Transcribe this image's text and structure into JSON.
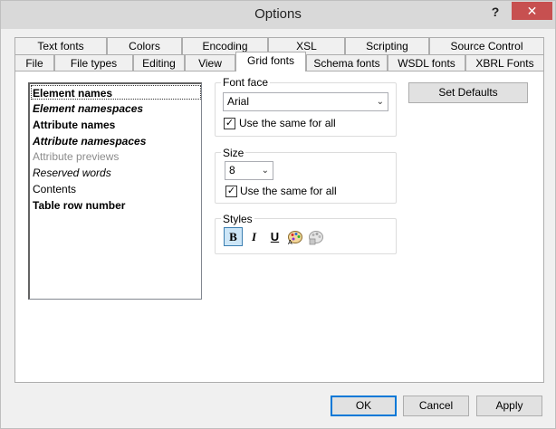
{
  "window": {
    "title": "Options",
    "help_label": "?",
    "close_label": "✕"
  },
  "tabs": {
    "row1": [
      "Text fonts",
      "Colors",
      "Encoding",
      "XSL",
      "Scripting",
      "Source Control"
    ],
    "row2": [
      "File",
      "File types",
      "Editing",
      "View",
      "Grid fonts",
      "Schema fonts",
      "WSDL fonts",
      "XBRL Fonts"
    ],
    "active": "Grid fonts"
  },
  "font_list": [
    {
      "label": "Element names",
      "style": "bold",
      "selected": true
    },
    {
      "label": "Element namespaces",
      "style": "bold-italic"
    },
    {
      "label": "Attribute names",
      "style": "bold"
    },
    {
      "label": "Attribute namespaces",
      "style": "bold-italic"
    },
    {
      "label": "Attribute previews",
      "style": "gray"
    },
    {
      "label": "Reserved words",
      "style": "italic"
    },
    {
      "label": "Contents",
      "style": "normal"
    },
    {
      "label": "Table row number",
      "style": "bold"
    }
  ],
  "font_face": {
    "group_label": "Font face",
    "value": "Arial",
    "same_for_all_label": "Use the same for all",
    "same_for_all_checked": true
  },
  "size": {
    "group_label": "Size",
    "value": "8",
    "same_for_all_label": "Use the same for all",
    "same_for_all_checked": true
  },
  "styles": {
    "group_label": "Styles",
    "bold_glyph": "B",
    "italic_glyph": "I",
    "underline_glyph": "U",
    "bold_pressed": true
  },
  "set_defaults_label": "Set Defaults",
  "footer": {
    "ok_label": "OK",
    "cancel_label": "Cancel",
    "apply_label": "Apply"
  }
}
